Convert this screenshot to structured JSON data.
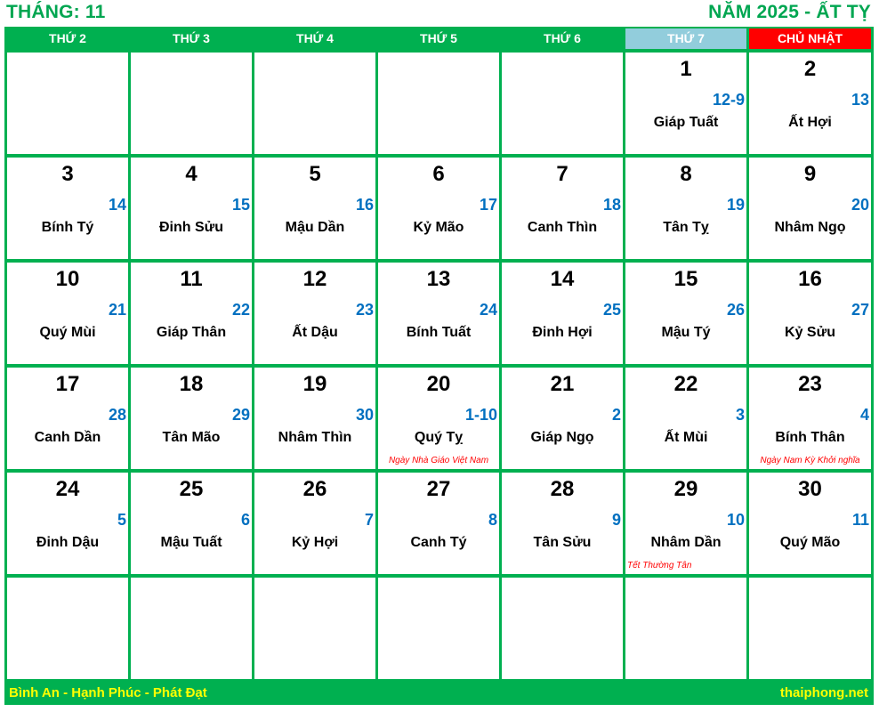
{
  "header": {
    "month_label": "THÁNG: 11",
    "year_label": "NĂM 2025 - ẤT TỴ"
  },
  "weekdays": [
    {
      "label": "THỨ 2",
      "type": "weekday"
    },
    {
      "label": "THỨ 3",
      "type": "weekday"
    },
    {
      "label": "THỨ 4",
      "type": "weekday"
    },
    {
      "label": "THỨ 5",
      "type": "weekday"
    },
    {
      "label": "THỨ 6",
      "type": "weekday"
    },
    {
      "label": "THỨ 7",
      "type": "saturday"
    },
    {
      "label": "CHỦ NHẬT",
      "type": "sunday"
    }
  ],
  "colors": {
    "brand_green": "#00b050",
    "saturday_header": "#92cddc",
    "sunday_header": "#ff0000",
    "lunar_blue": "#0070c0",
    "holiday_red": "#ff0000",
    "footer_text": "#ffff00"
  },
  "weeks": [
    [
      null,
      null,
      null,
      null,
      null,
      {
        "solar": "1",
        "lunar": "12-9",
        "canchi": "Giáp Tuất"
      },
      {
        "solar": "2",
        "lunar": "13",
        "canchi": "Ất Hợi"
      }
    ],
    [
      {
        "solar": "3",
        "lunar": "14",
        "canchi": "Bính Tý"
      },
      {
        "solar": "4",
        "lunar": "15",
        "canchi": "Đinh Sửu"
      },
      {
        "solar": "5",
        "lunar": "16",
        "canchi": "Mậu Dần"
      },
      {
        "solar": "6",
        "lunar": "17",
        "canchi": "Kỷ Mão"
      },
      {
        "solar": "7",
        "lunar": "18",
        "canchi": "Canh Thìn"
      },
      {
        "solar": "8",
        "lunar": "19",
        "canchi": "Tân Tỵ"
      },
      {
        "solar": "9",
        "lunar": "20",
        "canchi": "Nhâm Ngọ"
      }
    ],
    [
      {
        "solar": "10",
        "lunar": "21",
        "canchi": "Quý Mùi"
      },
      {
        "solar": "11",
        "lunar": "22",
        "canchi": "Giáp Thân"
      },
      {
        "solar": "12",
        "lunar": "23",
        "canchi": "Ất Dậu"
      },
      {
        "solar": "13",
        "lunar": "24",
        "canchi": "Bính Tuất"
      },
      {
        "solar": "14",
        "lunar": "25",
        "canchi": "Đinh Hợi"
      },
      {
        "solar": "15",
        "lunar": "26",
        "canchi": "Mậu Tý"
      },
      {
        "solar": "16",
        "lunar": "27",
        "canchi": "Kỷ Sửu"
      }
    ],
    [
      {
        "solar": "17",
        "lunar": "28",
        "canchi": "Canh Dần"
      },
      {
        "solar": "18",
        "lunar": "29",
        "canchi": "Tân Mão"
      },
      {
        "solar": "19",
        "lunar": "30",
        "canchi": "Nhâm Thìn"
      },
      {
        "solar": "20",
        "lunar": "1-10",
        "canchi": "Quý Tỵ",
        "holiday": "Ngày Nhà Giáo Việt Nam"
      },
      {
        "solar": "21",
        "lunar": "2",
        "canchi": "Giáp Ngọ"
      },
      {
        "solar": "22",
        "lunar": "3",
        "canchi": "Ất Mùi"
      },
      {
        "solar": "23",
        "lunar": "4",
        "canchi": "Bính Thân",
        "holiday": "Ngày Nam Kỳ Khởi nghĩa"
      }
    ],
    [
      {
        "solar": "24",
        "lunar": "5",
        "canchi": "Đinh Dậu"
      },
      {
        "solar": "25",
        "lunar": "6",
        "canchi": "Mậu Tuất"
      },
      {
        "solar": "26",
        "lunar": "7",
        "canchi": "Kỷ Hợi"
      },
      {
        "solar": "27",
        "lunar": "8",
        "canchi": "Canh Tý"
      },
      {
        "solar": "28",
        "lunar": "9",
        "canchi": "Tân Sửu"
      },
      {
        "solar": "29",
        "lunar": "10",
        "canchi": "Nhâm Dần",
        "holiday": "Tết Thường Tân"
      },
      {
        "solar": "30",
        "lunar": "11",
        "canchi": "Quý Mão"
      }
    ],
    [
      null,
      null,
      null,
      null,
      null,
      null,
      null
    ]
  ],
  "footer": {
    "slogan": "Bình An - Hạnh Phúc - Phát Đạt",
    "website": "thaiphong.net"
  }
}
